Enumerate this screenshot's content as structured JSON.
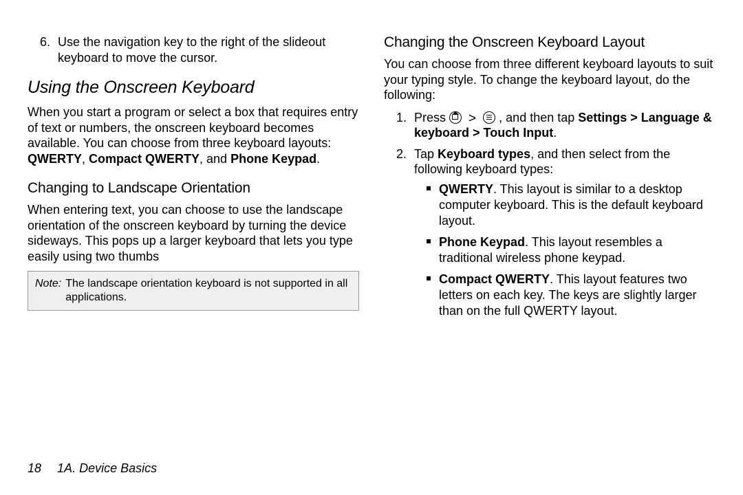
{
  "left": {
    "step6_num": "6.",
    "step6_text": "Use the navigation key to the right of the slideout keyboard to move the cursor.",
    "heading": "Using the Onscreen Keyboard",
    "intro_pre": "When you start a program or select a box that requires entry of text or numbers, the onscreen keyboard becomes available. You can choose from three keyboard layouts: ",
    "kw_qwerty": "QWERTY",
    "comma1": ", ",
    "kw_compact": "Compact QWERTY",
    "comma2": ", and ",
    "kw_phone": "Phone Keypad",
    "period": ".",
    "sub1": "Changing to Landscape Orientation",
    "sub1_text": "When entering text, you can choose to use the landscape orientation of the onscreen keyboard by turning the device sideways. This pops up a larger keyboard that lets you type easily using two thumbs",
    "note_label": "Note:",
    "note_text": "The landscape orientation keyboard is not supported in all applications."
  },
  "right": {
    "sub": "Changing the Onscreen Keyboard Layout",
    "intro": "You can choose from three different keyboard layouts to suit your typing style. To change the keyboard layout, do the following:",
    "step1_num": "1.",
    "step1_pre": "Press ",
    "step1_mid": " , and then tap ",
    "step1_settings": "Settings > Language & keyboard > Touch Input",
    "step1_post": ".",
    "step2_num": "2.",
    "step2_pre": "Tap ",
    "step2_kw": "Keyboard types",
    "step2_post": ", and then select from the following keyboard types:",
    "b1_kw": "QWERTY",
    "b1_text": ". This layout is similar to a desktop computer keyboard. This is the default keyboard layout.",
    "b2_kw": "Phone Keypad",
    "b2_text": ". This layout resembles a traditional wireless phone keypad.",
    "b3_kw": "Compact QWERTY",
    "b3_text": ". This layout features two letters on each key. The keys are slightly larger than on the full QWERTY layout."
  },
  "footer": {
    "page": "18",
    "section": "1A. Device Basics"
  }
}
